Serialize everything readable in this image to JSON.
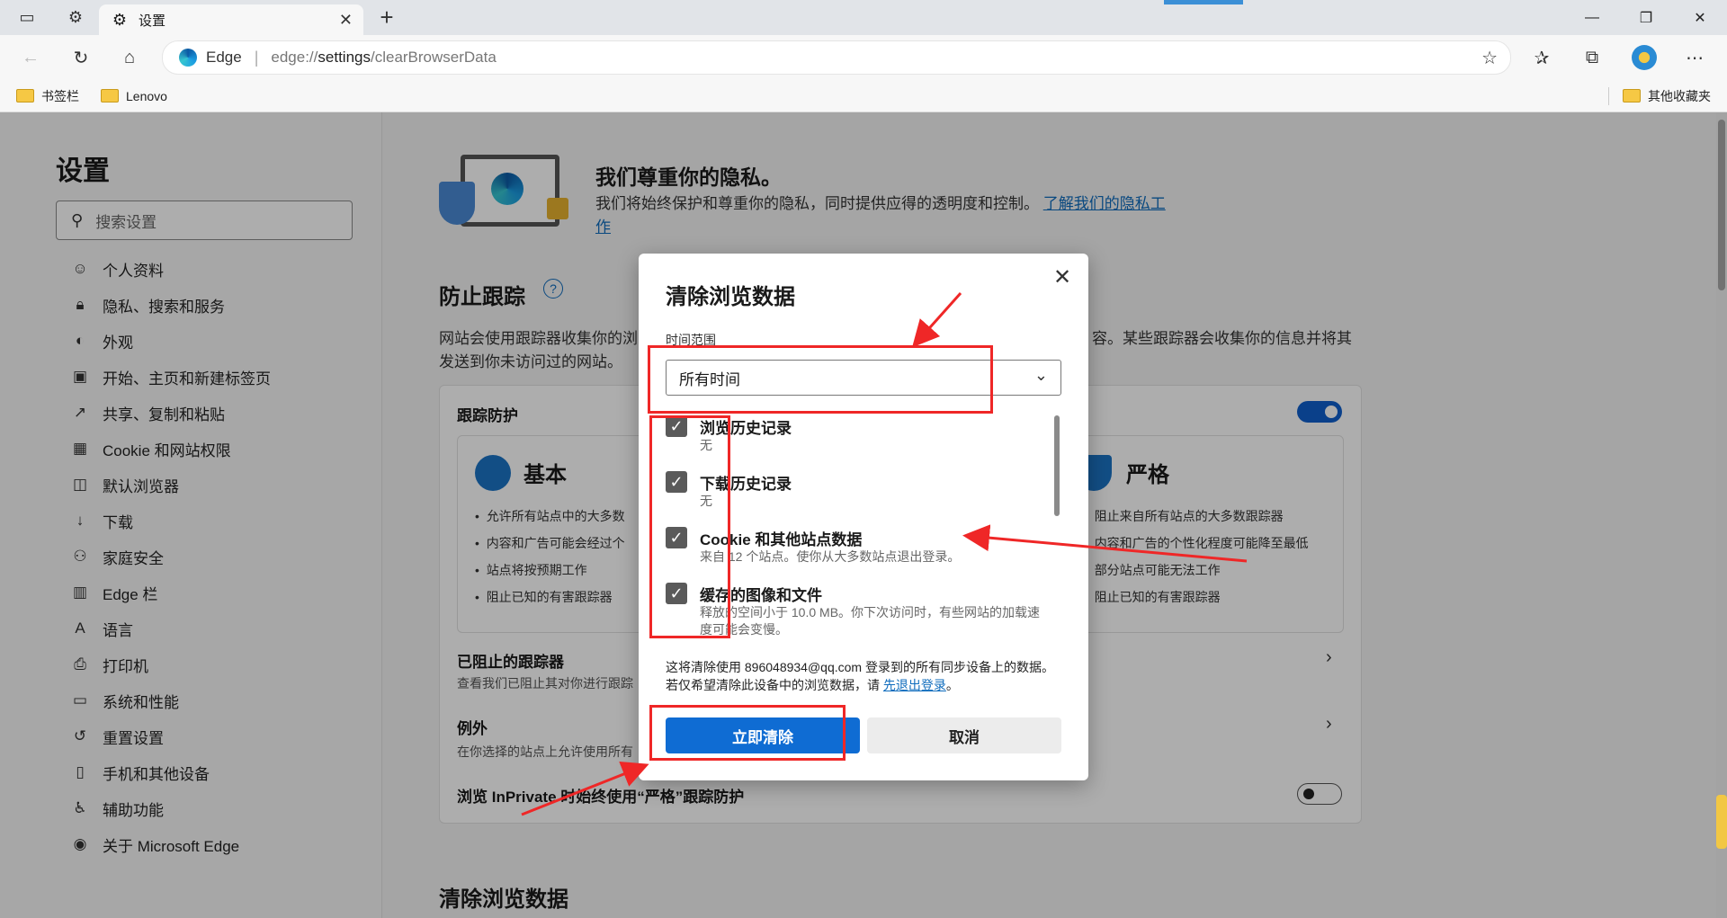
{
  "browser": {
    "tab_title": "设置",
    "address_brand": "Edge",
    "address_url_prefix": "edge://",
    "address_url_main": "settings",
    "address_url_rest": "/clearBrowserData",
    "bookmarks": [
      "书签栏",
      "Lenovo"
    ],
    "other_bookmarks": "其他收藏夹"
  },
  "sidebar": {
    "title": "设置",
    "search_placeholder": "搜索设置",
    "items": [
      {
        "label": "个人资料",
        "icon": "profile-icon"
      },
      {
        "label": "隐私、搜索和服务",
        "icon": "lock-icon"
      },
      {
        "label": "外观",
        "icon": "palette-icon"
      },
      {
        "label": "开始、主页和新建标签页",
        "icon": "home-grid-icon"
      },
      {
        "label": "共享、复制和粘贴",
        "icon": "share-icon"
      },
      {
        "label": "Cookie 和网站权限",
        "icon": "cookie-icon"
      },
      {
        "label": "默认浏览器",
        "icon": "browser-icon"
      },
      {
        "label": "下载",
        "icon": "download-icon"
      },
      {
        "label": "家庭安全",
        "icon": "family-icon"
      },
      {
        "label": "Edge 栏",
        "icon": "edge-bar-icon"
      },
      {
        "label": "语言",
        "icon": "language-icon"
      },
      {
        "label": "打印机",
        "icon": "printer-icon"
      },
      {
        "label": "系统和性能",
        "icon": "laptop-icon"
      },
      {
        "label": "重置设置",
        "icon": "reset-icon"
      },
      {
        "label": "手机和其他设备",
        "icon": "phone-icon"
      },
      {
        "label": "辅助功能",
        "icon": "accessibility-icon"
      },
      {
        "label": "关于 Microsoft Edge",
        "icon": "edge-logo-icon"
      }
    ]
  },
  "content": {
    "privacy_heading": "我们尊重你的隐私。",
    "privacy_text": "我们将始终保护和尊重你的隐私，同时提供应得的透明度和控制。",
    "privacy_link_line1": "了解我们的隐私工",
    "privacy_link_line2": "作",
    "tracking_heading": "防止跟踪",
    "tracking_desc_left1": "网站会使用跟踪器收集你的浏",
    "tracking_desc_right1": "容。某些跟踪器会收集你的信息并将其",
    "tracking_desc_line2": "发送到你未访问过的网站。",
    "tracking_card_title": "跟踪防护",
    "basic_title": "基本",
    "basic_bullets": [
      "允许所有站点中的大多数",
      "内容和广告可能会经过个",
      "站点将按预期工作",
      "阻止已知的有害跟踪器"
    ],
    "strict_title": "严格",
    "strict_bullets": [
      "阻止来自所有站点的大多数跟踪器",
      "内容和广告的个性化程度可能降至最低",
      "部分站点可能无法工作",
      "阻止已知的有害跟踪器"
    ],
    "blocked_title": "已阻止的跟踪器",
    "blocked_sub": "查看我们已阻止其对你进行跟踪",
    "exceptions_title": "例外",
    "exceptions_sub": "在你选择的站点上允许使用所有",
    "inprivate_label": "浏览 InPrivate 时始终使用“严格”跟踪防护",
    "clear_heading": "清除浏览数据"
  },
  "dialog": {
    "title": "清除浏览数据",
    "range_label": "时间范围",
    "range_value": "所有时间",
    "items": [
      {
        "label": "浏览历史记录",
        "sub": "无",
        "checked": true
      },
      {
        "label": "下载历史记录",
        "sub": "无",
        "checked": true
      },
      {
        "label": "Cookie 和其他站点数据",
        "sub": "来自 12 个站点。使你从大多数站点退出登录。",
        "checked": true
      },
      {
        "label": "缓存的图像和文件",
        "sub": "释放的空间小于 10.0 MB。你下次访问时，有些网站的加载速度可能会变慢。",
        "checked": true
      }
    ],
    "note_text": "这将清除使用 896048934@qq.com 登录到的所有同步设备上的数据。若仅希望清除此设备中的浏览数据，请 ",
    "note_link": "先退出登录",
    "note_end": "。",
    "clear_button": "立即清除",
    "cancel_button": "取消"
  },
  "colors": {
    "accent": "#0f6cd3",
    "annotation_red": "#ef2727"
  }
}
